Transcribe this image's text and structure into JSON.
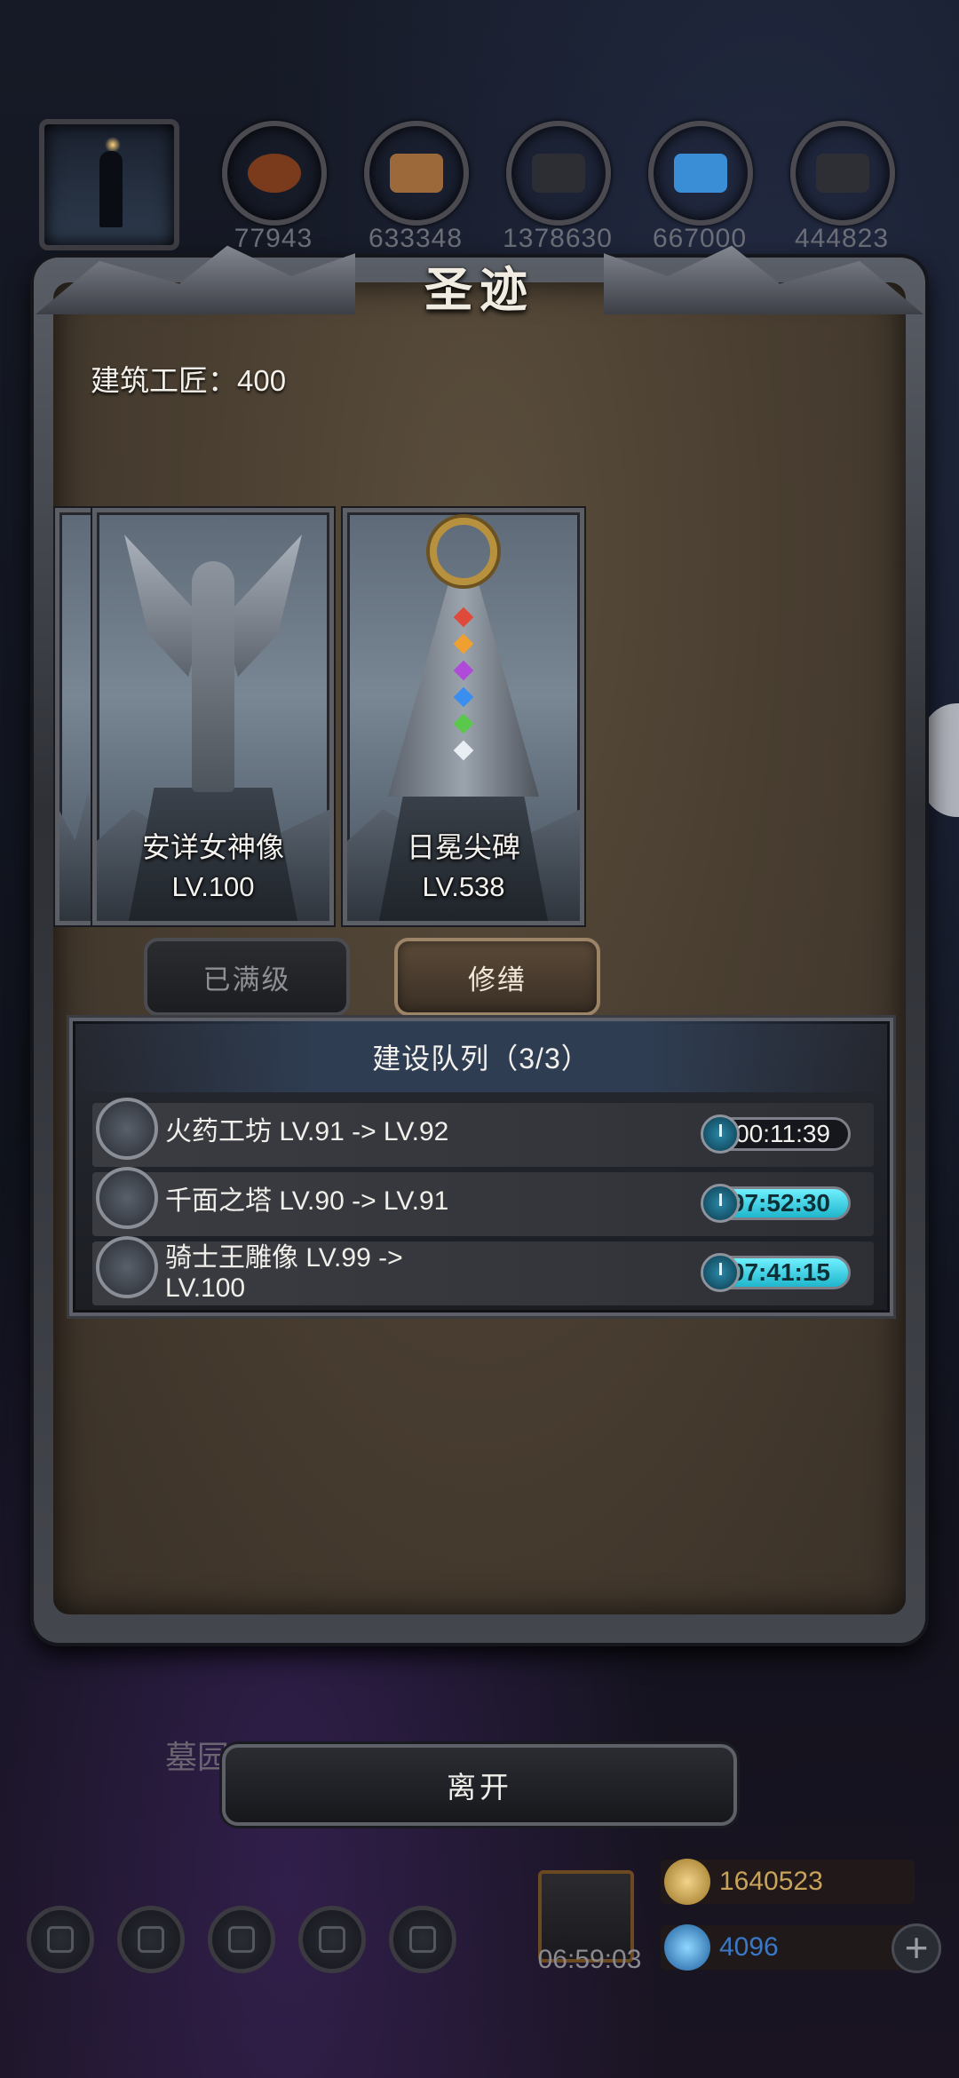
{
  "resources": {
    "values": [
      "77943",
      "633348",
      "1378630",
      "667000",
      "444823"
    ],
    "colors": [
      "#7a3b1d",
      "#9c6a3a",
      "#2c2e33",
      "#3a8ed6",
      "#2d2f35"
    ]
  },
  "dialog": {
    "title": "圣迹",
    "craftsmen_label": "建筑工匠：400"
  },
  "buildings": [
    {
      "name": "安详女神像",
      "level": "LV.100",
      "button": "已满级",
      "button_state": "maxed"
    },
    {
      "name": "日冕尖碑",
      "level": "LV.538",
      "button": "修缮",
      "button_state": "active"
    }
  ],
  "queue": {
    "title": "建设队列（3/3）",
    "items": [
      {
        "text": "火药工坊 LV.91 -> LV.92",
        "timer": "00:11:39",
        "timer_active": false
      },
      {
        "text": "千面之塔 LV.90 -> LV.91",
        "timer": "97:52:30",
        "timer_active": true
      },
      {
        "text": "骑士王雕像 LV.99 -> LV.100",
        "timer": "107:41:15",
        "timer_active": true
      }
    ]
  },
  "leave_button": "离开",
  "hud": {
    "location_label": "墓园",
    "gift_timer": "06:59:03",
    "gold": "1640523",
    "gems": "4096",
    "plus": "+"
  },
  "colors": {
    "accent_cyan": "#2fd4ea",
    "gold": "#c9a35a",
    "gems": "#3a78c8"
  }
}
